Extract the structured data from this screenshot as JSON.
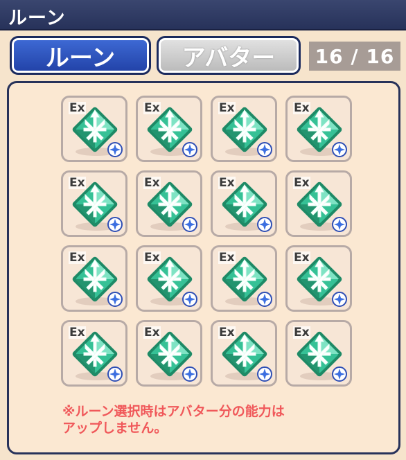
{
  "header": {
    "title": "ルーン"
  },
  "tabs": [
    {
      "label": "ルーン",
      "active": true
    },
    {
      "label": "アバター",
      "active": false
    }
  ],
  "counter": {
    "text": "16 / 16"
  },
  "runes": [
    {
      "badge": "Ex",
      "gem_icon": "emerald-arrow-gem-icon",
      "star_icon": "blue-star-icon"
    },
    {
      "badge": "Ex",
      "gem_icon": "emerald-arrow-gem-icon",
      "star_icon": "blue-star-icon"
    },
    {
      "badge": "Ex",
      "gem_icon": "emerald-arrow-gem-icon",
      "star_icon": "blue-star-icon"
    },
    {
      "badge": "Ex",
      "gem_icon": "emerald-arrow-gem-icon",
      "star_icon": "blue-star-icon"
    },
    {
      "badge": "Ex",
      "gem_icon": "emerald-arrow-gem-icon",
      "star_icon": "blue-star-icon"
    },
    {
      "badge": "Ex",
      "gem_icon": "emerald-arrow-gem-icon",
      "star_icon": "blue-star-icon"
    },
    {
      "badge": "Ex",
      "gem_icon": "emerald-arrow-gem-icon",
      "star_icon": "blue-star-icon"
    },
    {
      "badge": "Ex",
      "gem_icon": "emerald-arrow-gem-icon",
      "star_icon": "blue-star-icon"
    },
    {
      "badge": "Ex",
      "gem_icon": "emerald-arrow-gem-icon",
      "star_icon": "blue-star-icon"
    },
    {
      "badge": "Ex",
      "gem_icon": "emerald-arrow-gem-icon",
      "star_icon": "blue-star-icon"
    },
    {
      "badge": "Ex",
      "gem_icon": "emerald-arrow-gem-icon",
      "star_icon": "blue-star-icon"
    },
    {
      "badge": "Ex",
      "gem_icon": "emerald-arrow-gem-icon",
      "star_icon": "blue-star-icon"
    },
    {
      "badge": "Ex",
      "gem_icon": "emerald-arrow-gem-icon",
      "star_icon": "blue-star-icon"
    },
    {
      "badge": "Ex",
      "gem_icon": "emerald-arrow-gem-icon",
      "star_icon": "blue-star-icon"
    },
    {
      "badge": "Ex",
      "gem_icon": "emerald-arrow-gem-icon",
      "star_icon": "blue-star-icon"
    },
    {
      "badge": "Ex",
      "gem_icon": "emerald-arrow-gem-icon",
      "star_icon": "blue-star-icon"
    }
  ],
  "notice": {
    "line1": "※ルーン選択時はアバター分の能力は",
    "line2": "アップしません。"
  },
  "colors": {
    "header_bg": "#2f3a63",
    "tab_active": "#2f55c4",
    "tab_inactive": "#c8c8c8",
    "panel_border": "#27325a",
    "notice_text": "#f0585a",
    "gem": "#2fb58a"
  }
}
